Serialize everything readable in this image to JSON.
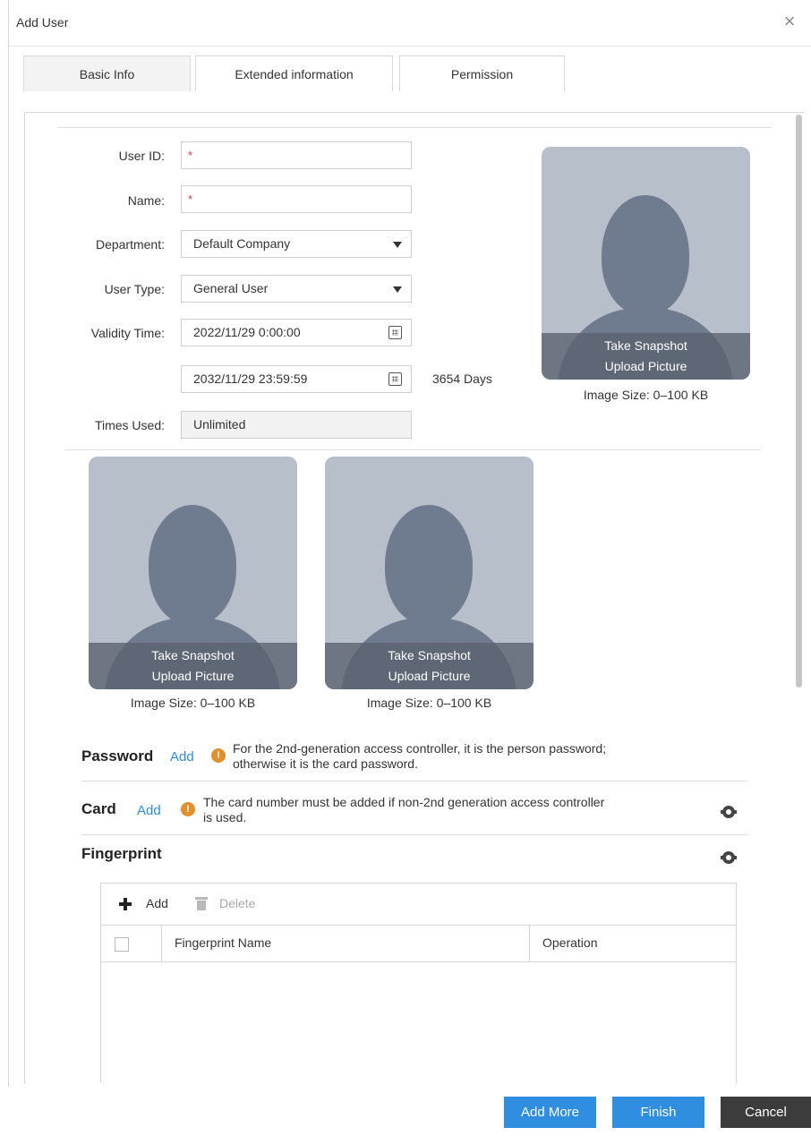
{
  "window": {
    "title": "Add User"
  },
  "tabs": [
    {
      "label": "Basic Info",
      "active": true
    },
    {
      "label": "Extended information",
      "active": false
    },
    {
      "label": "Permission",
      "active": false
    }
  ],
  "form": {
    "user_id_label": "User ID:",
    "user_id_required": "*",
    "name_label": "Name:",
    "name_required": "*",
    "department_label": "Department:",
    "department_value": "Default Company",
    "user_type_label": "User Type:",
    "user_type_value": "General User",
    "validity_label": "Validity Time:",
    "validity_start": "2022/11/29 0:00:00",
    "validity_end": "2032/11/29 23:59:59",
    "validity_days": "3654 Days",
    "times_used_label": "Times Used:",
    "times_used_value": "Unlimited"
  },
  "photos": [
    {
      "snapshot_label": "Take Snapshot",
      "upload_label": "Upload Picture",
      "size_note": "Image Size: 0–100 KB"
    },
    {
      "snapshot_label": "Take Snapshot",
      "upload_label": "Upload Picture",
      "size_note": "Image Size: 0–100 KB"
    },
    {
      "snapshot_label": "Take Snapshot",
      "upload_label": "Upload Picture",
      "size_note": "Image Size: 0–100 KB"
    }
  ],
  "password": {
    "title": "Password",
    "add_label": "Add",
    "note_line1": "For the 2nd-generation access controller, it is the person password;",
    "note_line2": "otherwise it is the card password."
  },
  "card": {
    "title": "Card",
    "add_label": "Add",
    "note_line1": "The card number must be added if non-2nd generation access controller",
    "note_line2": "is used."
  },
  "fingerprint": {
    "title": "Fingerprint",
    "toolbar_add": "Add",
    "toolbar_delete": "Delete",
    "columns": [
      "Fingerprint Name",
      "Operation"
    ]
  },
  "footer": {
    "add_more_label": "Add More",
    "finish_label": "Finish",
    "cancel_label": "Cancel"
  },
  "colors": {
    "accent": "#2f8ee0",
    "link": "#2a8de0",
    "required": "#e23b3b",
    "warning": "#e38f2c",
    "cancel_button": "#3c3c3c",
    "avatar_bg": "#b7bfcb",
    "avatar_silhouette": "#6f7b8f"
  },
  "icons": {
    "close": "close-icon",
    "dropdown": "chevron-down-icon",
    "calendar": "calendar-icon",
    "warning": "warning-icon",
    "settings": "gear-icon",
    "add": "plus-icon",
    "delete": "trash-icon"
  }
}
